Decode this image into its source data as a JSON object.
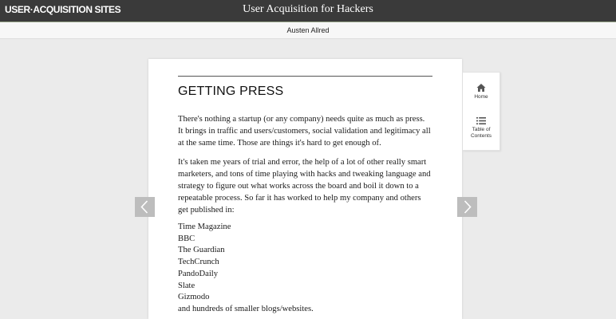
{
  "header": {
    "logo_text": "USER·ACQUISITION SITES",
    "book_title": "User Acquisition for Hackers",
    "author": "Austen Allred"
  },
  "chapter": {
    "title": "GETTING PRESS",
    "paragraphs": [
      "There's nothing a startup (or any company) needs quite as much as press. It brings in traffic and users/customers, social validation and legitimacy all at the same time. Those are things it's hard to get enough of.",
      "It's taken me years of trial and error, the help of a lot of other really smart marketers, and tons of time playing with hacks and tweaking language and strategy to figure out what works across the board and boil it down to a repeatable process. So far it has worked to help my company and others get published in:"
    ],
    "publications": [
      "Time Magazine",
      "BBC",
      "The Guardian",
      "TechCrunch",
      "PandoDaily",
      "Slate",
      "Gizmodo",
      "and hundreds of smaller blogs/websites."
    ]
  },
  "side_nav": {
    "home_label": "Home",
    "home_icon": "home-icon",
    "toc_label_line1": "Table of",
    "toc_label_line2": "Contents",
    "toc_icon": "list-icon"
  },
  "navigation": {
    "prev_icon": "chevron-left-icon",
    "next_icon": "chevron-right-icon"
  },
  "colors": {
    "topbar": "#3a3a3a",
    "background": "#ebebeb",
    "arrow_button": "#bdbdbd"
  }
}
